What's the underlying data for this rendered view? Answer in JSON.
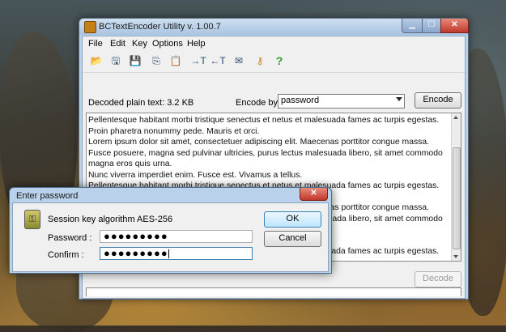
{
  "main_window": {
    "title": "BCTextEncoder Utility v. 1.00.7",
    "controls": {
      "minimize": "▁",
      "maximize": "☐",
      "close": "✕"
    }
  },
  "menu": [
    "File",
    "Edit",
    "Key",
    "Options",
    "Help"
  ],
  "toolbar": [
    {
      "name": "open-icon",
      "glyph": "📂"
    },
    {
      "name": "save-as-icon",
      "glyph": "🖫"
    },
    {
      "name": "save-icon",
      "glyph": "💾"
    },
    {
      "name": "copy-icon",
      "glyph": "⎘"
    },
    {
      "name": "paste-icon",
      "glyph": "📋"
    },
    {
      "name": "encode-text-icon",
      "glyph": "→T"
    },
    {
      "name": "decode-text-icon",
      "glyph": "←T"
    },
    {
      "name": "message-icon",
      "glyph": "✉"
    },
    {
      "name": "key-icon",
      "glyph": "⚷"
    },
    {
      "name": "help-icon",
      "glyph": "?"
    }
  ],
  "status": {
    "decoded_label": "Decoded plain text: 3.2 KB"
  },
  "encode": {
    "label": "Encode by:",
    "selected": "password",
    "button": "Encode"
  },
  "editor_text": "Pellentesque habitant morbi tristique senectus et netus et malesuada fames ac turpis egestas. Proin pharetra nonummy pede. Mauris et orci.\nLorem ipsum dolor sit amet, consectetuer adipiscing elit. Maecenas porttitor congue massa. Fusce posuere, magna sed pulvinar ultricies, purus lectus malesuada libero, sit amet commodo magna eros quis urna.\nNunc viverra imperdiet enim. Fusce est. Vivamus a tellus.\nPellentesque habitant morbi tristique senectus et netus et malesuada fames ac turpis egestas. Proin pharetra nonummy pede. Mauris et orci.\nLorem ipsum dolor sit amet, consectetuer adipiscing elit. Maecenas porttitor congue massa. Fusce posuere, magna sed pulvinar ultricies, purus lectus malesuada libero, sit amet commodo magna eros quis urna.\nNunc viverra imperdiet enim. Fusce est. Vivamus a tellus.\nPellentesque habitant morbi tristique senectus et netus et malesuada fames ac turpis egestas. Proin pharetra nonummy pede. Mauris et orci.\nLorem ipsum dolor sit amet, consectetuer adipiscing elit. Maecenas porttitor congue massa. Fusce posuere, magna sed pulvinar ultricies, purus lectus malesuada libero, sit amet commodo magna eros quis urna.\nNunc viverra imperdiet enim. Fusce est. Vivamus a tellus.",
  "decode_button": "Decode",
  "dialog": {
    "title": "Enter password",
    "close": "✕",
    "algorithm": "Session key algorithm AES-256",
    "password_label": "Password :",
    "confirm_label": "Confirm :",
    "password_value": "●●●●●●●●●",
    "confirm_value": "●●●●●●●●●",
    "ok": "OK",
    "cancel": "Cancel"
  },
  "colors": {
    "titlebar": "#b9d1ea",
    "close": "#c0392b",
    "window_bg": "#f0f0f0"
  }
}
